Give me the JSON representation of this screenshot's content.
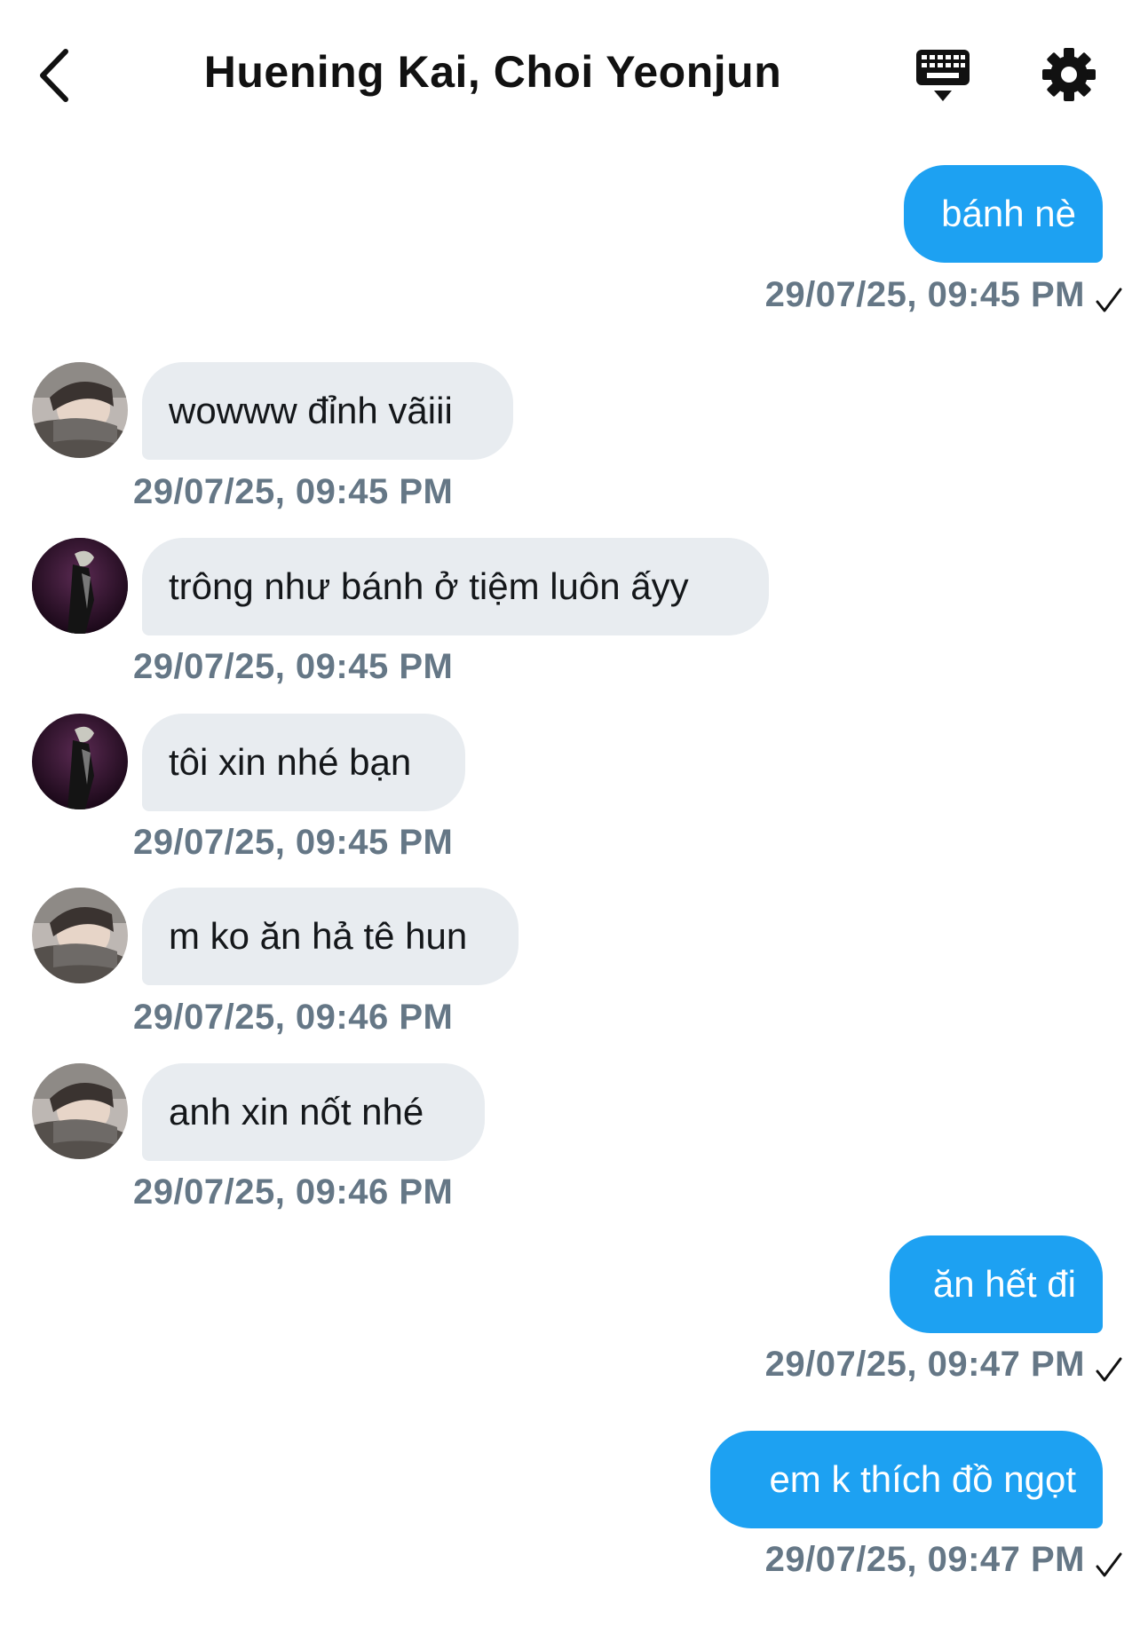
{
  "header": {
    "title": "Huening Kai, Choi Yeonjun"
  },
  "messages": [
    {
      "text": "bánh nè",
      "time": "29/07/25, 09:45 PM"
    },
    {
      "text": "wowww đỉnh vãiii",
      "time": "29/07/25, 09:45 PM"
    },
    {
      "text": "trông như bánh ở tiệm luôn ấyy",
      "time": "29/07/25, 09:45 PM"
    },
    {
      "text": "tôi xin nhé bạn",
      "time": "29/07/25, 09:45 PM"
    },
    {
      "text": "m ko ăn hả tê hun",
      "time": "29/07/25, 09:46 PM"
    },
    {
      "text": "anh xin nốt nhé",
      "time": "29/07/25, 09:46 PM"
    },
    {
      "text": "ăn hết đi",
      "time": "29/07/25, 09:47 PM"
    },
    {
      "text": "em k thích đồ ngọt",
      "time": "29/07/25, 09:47 PM"
    }
  ],
  "colors": {
    "sent_bubble": "#1da1f2",
    "received_bubble": "#e8ecf0",
    "timestamp": "#657786"
  },
  "icons": {
    "back": "chevron-left-icon",
    "keyboard": "keyboard-icon",
    "settings": "gear-icon",
    "read_receipt": "checkmark-icon"
  }
}
